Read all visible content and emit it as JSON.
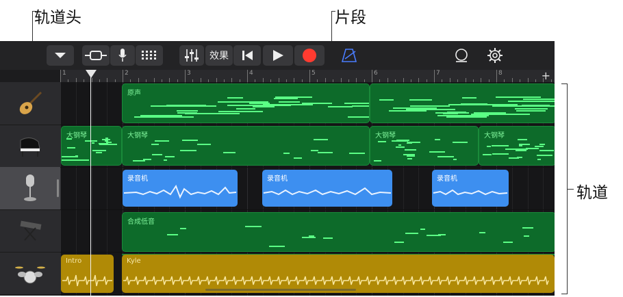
{
  "callouts": {
    "track_header": "轨道头",
    "region": "片段",
    "tracks": "轨道"
  },
  "toolbar": {
    "effects_label": "效果",
    "buttons": [
      "menu-down",
      "view-toggle",
      "microphone",
      "grid",
      "mixer",
      "effects",
      "go-to-start",
      "play",
      "record",
      "metronome",
      "loop",
      "settings"
    ],
    "accent_color": "#4a7dff",
    "record_color": "#ff3b30"
  },
  "ruler": {
    "bars": [
      "1",
      "2",
      "3",
      "4",
      "5",
      "6",
      "7",
      "8"
    ]
  },
  "tracks": [
    {
      "icon": "acoustic-guitar-icon",
      "selected": false
    },
    {
      "icon": "grand-piano-icon",
      "selected": false
    },
    {
      "icon": "microphone-icon",
      "selected": true
    },
    {
      "icon": "synth-keyboard-icon",
      "selected": false
    },
    {
      "icon": "drum-kit-icon",
      "selected": false
    }
  ],
  "regions": {
    "guitar": [
      "原声"
    ],
    "piano": [
      "大钢琴",
      "大钢琴",
      "大钢琴",
      "大钢琴"
    ],
    "recorder": [
      "录音机",
      "录音机",
      "录音机"
    ],
    "bass": [
      "合成低音"
    ],
    "drums": [
      "Intro",
      "Kyle"
    ]
  },
  "colors": {
    "midi_region": "#0d6b2a",
    "audio_region": "#3d8ff0",
    "drummer_region": "#b08a06"
  }
}
